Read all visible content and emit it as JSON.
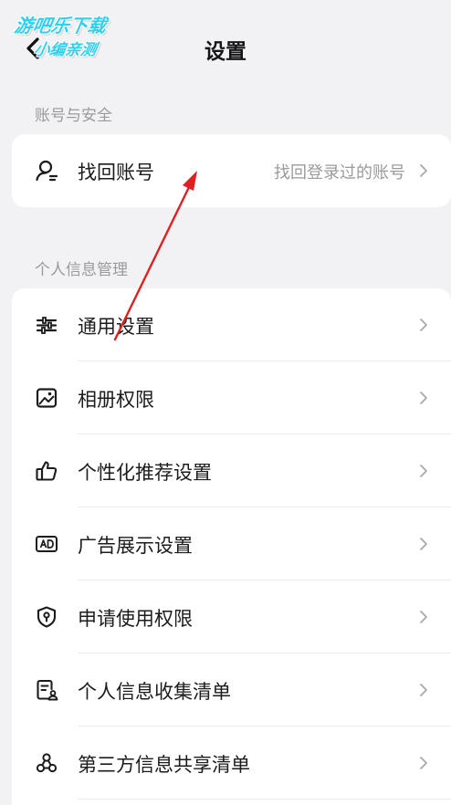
{
  "header": {
    "title": "设置",
    "back_icon": "chevron-left-icon"
  },
  "watermark": {
    "line1": "游吧乐下载",
    "line2": "小编亲测",
    "color": "#2fd0f0"
  },
  "sections": {
    "account": {
      "label": "账号与安全",
      "items": [
        {
          "label": "找回账号",
          "value": "找回登录过的账号",
          "icon": "user-search-icon"
        }
      ]
    },
    "personal": {
      "label": "个人信息管理",
      "items": [
        {
          "label": "通用设置",
          "icon": "sliders-icon"
        },
        {
          "label": "相册权限",
          "icon": "image-icon"
        },
        {
          "label": "个性化推荐设置",
          "icon": "thumbs-up-icon"
        },
        {
          "label": "广告展示设置",
          "icon": "ad-icon"
        },
        {
          "label": "申请使用权限",
          "icon": "shield-icon"
        },
        {
          "label": "个人信息收集清单",
          "icon": "document-user-icon"
        },
        {
          "label": "第三方信息共享清单",
          "icon": "share-nodes-icon"
        }
      ]
    }
  },
  "colors": {
    "background": "#f2f2f4",
    "card": "#ffffff",
    "annotation_arrow": "#e02020"
  }
}
